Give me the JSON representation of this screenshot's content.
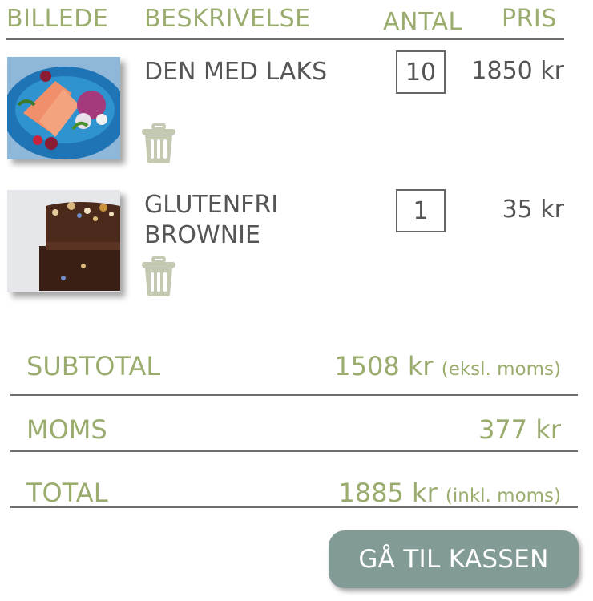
{
  "header": {
    "image": "BILLEDE",
    "description": "BESKRIVELSE",
    "quantity": "ANTAL",
    "price": "PRIS"
  },
  "items": [
    {
      "name": "DEN MED LAKS",
      "quantity": "10",
      "price": "1850 kr",
      "image_icon": "salmon-dish-photo",
      "delete_icon": "trash-icon"
    },
    {
      "name_line1": "GLUTENFRI",
      "name_line2": "BROWNIE",
      "quantity": "1",
      "price": "35 kr",
      "image_icon": "brownie-photo",
      "delete_icon": "trash-icon"
    }
  ],
  "summary": {
    "subtotal_label": "SUBTOTAL",
    "subtotal_value": "1508 kr",
    "subtotal_note": "(eksl. moms)",
    "vat_label": "MOMS",
    "vat_value": "377 kr",
    "total_label": "TOTAL",
    "total_value": "1885 kr",
    "total_note": "(inkl. moms)"
  },
  "checkout_label": "GÅ TIL KASSEN",
  "colors": {
    "accent_green": "#9aad6e",
    "button": "#839b96",
    "text": "#555555",
    "trash": "#c4c9b2"
  }
}
